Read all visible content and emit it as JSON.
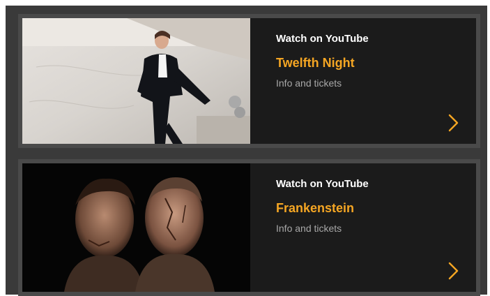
{
  "items": [
    {
      "watch_label": "Watch on YouTube",
      "title": "Twelfth Night",
      "subtitle": "Info and tickets",
      "image": "woman-in-black-suit-photo"
    },
    {
      "watch_label": "Watch on YouTube",
      "title": "Frankenstein",
      "subtitle": "Info and tickets",
      "image": "two-faces-dark-photo"
    }
  ],
  "colors": {
    "accent": "#f5a623",
    "card_bg": "#1b1b1b",
    "frame_bg": "#3a3a3a"
  },
  "icons": {
    "next": "chevron-right-icon"
  }
}
